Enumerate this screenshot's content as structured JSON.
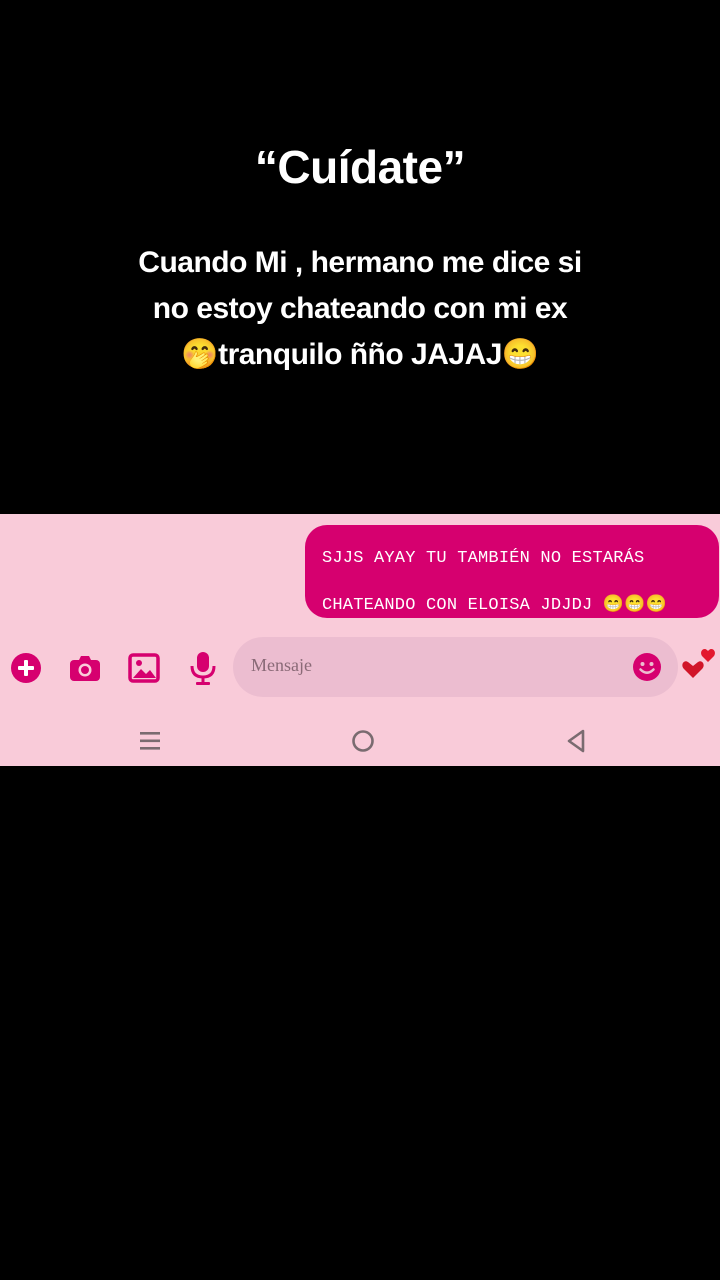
{
  "overlay": {
    "title": "“Cuídate”",
    "caption_line1": "Cuando Mi , hermano me dice si",
    "caption_line2": "no estoy chateando con mi ex",
    "caption_line3": "🤭tranquilo ñño JAJAJ😁"
  },
  "chat": {
    "bubble_line1": "SJJS AYAY TU TAMBIÉN NO ESTARÁS",
    "bubble_line2": "CHATEANDO CON ELOISA JDJDJ 😁😁😁"
  },
  "composer": {
    "placeholder": "Mensaje",
    "icons": [
      "plus-icon",
      "camera-icon",
      "gallery-icon",
      "microphone-icon",
      "emoji-icon",
      "hearts-icon"
    ]
  },
  "nav": {
    "icons": [
      "menu-icon",
      "home-icon",
      "back-icon"
    ]
  },
  "colors": {
    "accent": "#d6006f",
    "panel_bg": "#f9cbd9",
    "field_bg": "#ecbdd0",
    "nav_icon": "#7a6b70"
  }
}
